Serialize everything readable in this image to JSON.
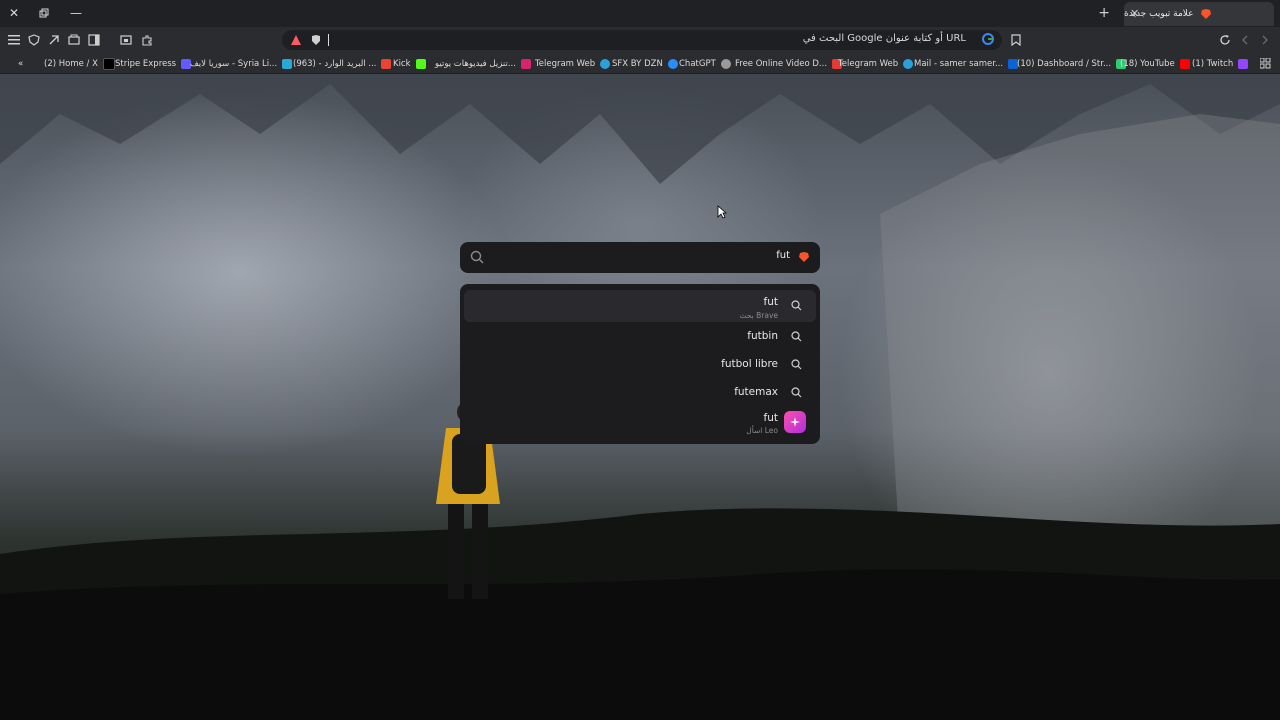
{
  "tab": {
    "title": "علامة تبويب جديدة"
  },
  "toolbar": {
    "omnibox_placeholder": "البحث في Google أو كتابة عنوان URL"
  },
  "bookmarks": [
    {
      "label": "(2) Home / X",
      "color": "#000000"
    },
    {
      "label": "Stripe Express",
      "color": "#635bff"
    },
    {
      "label": "سوريا لايف - Syria Li...",
      "color": "#2aa8d6"
    },
    {
      "label": "(963) - البريد الوارد ...",
      "color": "#ea4335"
    },
    {
      "label": "Kick",
      "color": "#53fc18"
    },
    {
      "label": "تنزيل فيديوهات يوتيو...",
      "color": "#d6246e"
    },
    {
      "label": "Telegram Web",
      "color": "#2aa1da"
    },
    {
      "label": "SFX BY DZN",
      "color": "#2b8cff"
    },
    {
      "label": "ChatGPT",
      "color": "#9a9a9a"
    },
    {
      "label": "Free Online Video D...",
      "color": "#e53935"
    },
    {
      "label": "Telegram Web",
      "color": "#2aa1da"
    },
    {
      "label": "Mail - samer samer...",
      "color": "#0a64d8"
    },
    {
      "label": "(10) Dashboard / Str...",
      "color": "#2ecc71"
    },
    {
      "label": "(18) YouTube",
      "color": "#ff0000"
    },
    {
      "label": "(1) Twitch",
      "color": "#9146ff"
    }
  ],
  "search": {
    "value": "fut"
  },
  "suggestions": [
    {
      "text": "fut",
      "sub": "بحث Brave",
      "icon": "search-icon"
    },
    {
      "text": "futbin",
      "sub": "",
      "icon": "search-icon"
    },
    {
      "text": "futbol libre",
      "sub": "",
      "icon": "search-icon"
    },
    {
      "text": "futemax",
      "sub": "",
      "icon": "search-icon"
    },
    {
      "text": "fut",
      "sub": "اسأل Leo",
      "icon": "leo-icon"
    }
  ]
}
